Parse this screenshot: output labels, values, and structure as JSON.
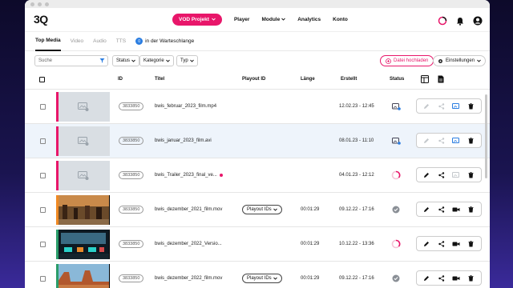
{
  "app": {
    "logo": "3Q"
  },
  "nav": {
    "project_label": "VOD Projekt",
    "links": [
      "Player",
      "Module",
      "Analytics",
      "Konto"
    ]
  },
  "tabs": [
    {
      "label": "Top Media",
      "active": true
    },
    {
      "label": "Video",
      "active": false
    },
    {
      "label": "Audio",
      "active": false
    },
    {
      "label": "TTS",
      "active": false
    }
  ],
  "queue": {
    "count": "0",
    "label": "in der Warteschlange"
  },
  "filters": {
    "search_placeholder": "Suche",
    "dropdowns": [
      "Status",
      "Kategorie",
      "Typ"
    ],
    "upload_label": "Datei hochladen",
    "settings_label": "Einstellungen"
  },
  "table": {
    "headers": {
      "id": "ID",
      "title": "Titel",
      "playout": "Playout ID",
      "length": "Länge",
      "created": "Erstellt",
      "status": "Status"
    },
    "rows": [
      {
        "id": "3833850",
        "title": "bwis_februar_2023_film.mp4",
        "playout": "",
        "length": "",
        "created": "12.02.23 - 12:45",
        "status": "upload",
        "selected": false,
        "bar": "#e8166a",
        "thumb": "placeholder",
        "warning": false
      },
      {
        "id": "3833850",
        "title": "bwis_januar_2023_film.avi",
        "playout": "",
        "length": "",
        "created": "08.01.23 - 11:10",
        "status": "upload",
        "selected": true,
        "bar": "#e8166a",
        "thumb": "placeholder",
        "warning": false
      },
      {
        "id": "3833850",
        "title": "bwis_Trailer_2023_final_ve...",
        "playout": "",
        "length": "",
        "created": "04.01.23 - 12:12",
        "status": "processing",
        "selected": false,
        "bar": "#e8166a",
        "thumb": "placeholder",
        "warning": true
      },
      {
        "id": "3833850",
        "title": "bwis_dezember_2021_film.mov",
        "playout": "Playout IDs",
        "length": "00:01:29",
        "created": "09.12.22 - 17:16",
        "status": "done",
        "selected": false,
        "bar": "#f08a24",
        "thumb": "street",
        "warning": false
      },
      {
        "id": "3833850",
        "title": "bwis_dezember_2022_Versio...",
        "playout": "",
        "length": "00:01:29",
        "created": "10.12.22 - 13:36",
        "status": "processing",
        "selected": false,
        "bar": "#2a9d6a",
        "thumb": "cockpit",
        "warning": false
      },
      {
        "id": "3833850",
        "title": "bwis_dezember_2022_film.mov",
        "playout": "Playout IDs",
        "length": "00:01:29",
        "created": "09.12.22 - 17:16",
        "status": "done",
        "selected": false,
        "bar": "#2a9d6a",
        "thumb": "desert",
        "warning": false
      }
    ]
  },
  "colors": {
    "accent": "#e8166a",
    "blue": "#2a7de1"
  }
}
